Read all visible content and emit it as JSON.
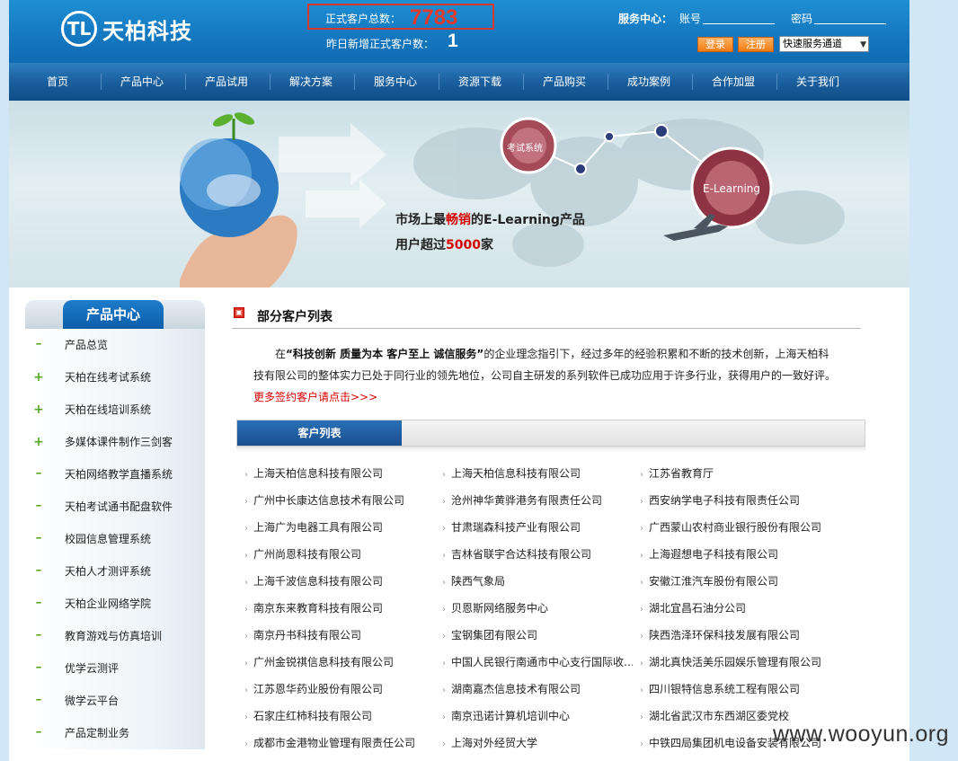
{
  "header": {
    "logo_mark": "TL",
    "logo_text": "天柏科技",
    "total_label": "正式客户总数：",
    "total_value": "7783",
    "new_label": "昨日新增正式客户数：",
    "new_value": "1",
    "service_label": "服务中心：",
    "account_label": "账号",
    "password_label": "密码",
    "login_label": "登录",
    "register_label": "注册",
    "quick_select_value": "快速服务通道"
  },
  "nav": {
    "items": [
      "首页",
      "产品中心",
      "产品试用",
      "解决方案",
      "服务中心",
      "资源下载",
      "产品购买",
      "成功案例",
      "合作加盟",
      "关于我们"
    ]
  },
  "banner": {
    "node1": "考试系统",
    "node2": "E-Learning",
    "line1_a": "市场上最",
    "line1_red": "畅销",
    "line1_b": "的E-Learning产品",
    "line2_a": "用户超过",
    "line2_red": "5000",
    "line2_b": "家"
  },
  "sidebar": {
    "title": "产品中心",
    "items": [
      {
        "icon": "minus",
        "label": "产品总览"
      },
      {
        "icon": "plus",
        "label": "天柏在线考试系统"
      },
      {
        "icon": "plus",
        "label": "天柏在线培训系统"
      },
      {
        "icon": "plus",
        "label": "多媒体课件制作三剑客"
      },
      {
        "icon": "minus",
        "label": "天柏网络教学直播系统"
      },
      {
        "icon": "minus",
        "label": "天柏考试通书配盘软件"
      },
      {
        "icon": "minus",
        "label": "校园信息管理系统"
      },
      {
        "icon": "minus",
        "label": "天柏人才测评系统"
      },
      {
        "icon": "minus",
        "label": "天柏企业网络学院"
      },
      {
        "icon": "minus",
        "label": "教育游戏与仿真培训"
      },
      {
        "icon": "minus",
        "label": "优学云测评"
      },
      {
        "icon": "minus",
        "label": "微学云平台"
      },
      {
        "icon": "minus",
        "label": "产品定制业务"
      }
    ]
  },
  "main": {
    "title": "部分客户列表",
    "intro_a": "在",
    "intro_bold": "“科技创新 质量为本 客户至上 诚信服务”",
    "intro_b": "的企业理念指引下，经过多年的经验积累和不断的技术创新，上海天柏科技有限公司的整体实力已处于同行业的领先地位，公司自主研发的系列软件已成功应用于许多行业，获得用户的一致好评。",
    "intro_more": "更多签约客户请点击>>>",
    "list_tab": "客户列表",
    "customers": [
      [
        "上海天柏信息科技有限公司",
        "上海天柏信息科技有限公司",
        "江苏省教育厅"
      ],
      [
        "广州中长康达信息技术有限公司",
        "沧州神华黄骅港务有限责任公司",
        "西安纳学电子科技有限责任公司"
      ],
      [
        "上海广为电器工具有限公司",
        "甘肃瑞森科技产业有限公司",
        "广西蒙山农村商业银行股份有限公司"
      ],
      [
        "广州尚恩科技有限公司",
        "吉林省联宇合达科技有限公司",
        "上海遐想电子科技有限公司"
      ],
      [
        "上海千波信息科技有限公司",
        "陕西气象局",
        "安徽江淮汽车股份有限公司"
      ],
      [
        "南京东来教育科技有限公司",
        "贝恩斯网络服务中心",
        "湖北宜昌石油分公司"
      ],
      [
        "南京丹书科技有限公司",
        "宝钢集团有限公司",
        "陕西浩泽环保科技发展有限公司"
      ],
      [
        "广州金锐祺信息科技有限公司",
        "中国人民银行南通市中心支行国际收…",
        "湖北真快活美乐园娱乐管理有限公司"
      ],
      [
        "江苏恩华药业股份有限公司",
        "湖南嘉杰信息技术有限公司",
        "四川银特信息系统工程有限公司"
      ],
      [
        "石家庄红柿科技有限公司",
        "南京迅诺计算机培训中心",
        "湖北省武汉市东西湖区委党校"
      ],
      [
        "成都市金港物业管理有限责任公司",
        "上海对外经贸大学",
        "中铁四局集团机电设备安装有限公司"
      ]
    ]
  },
  "watermark": "www.wooyun.org"
}
